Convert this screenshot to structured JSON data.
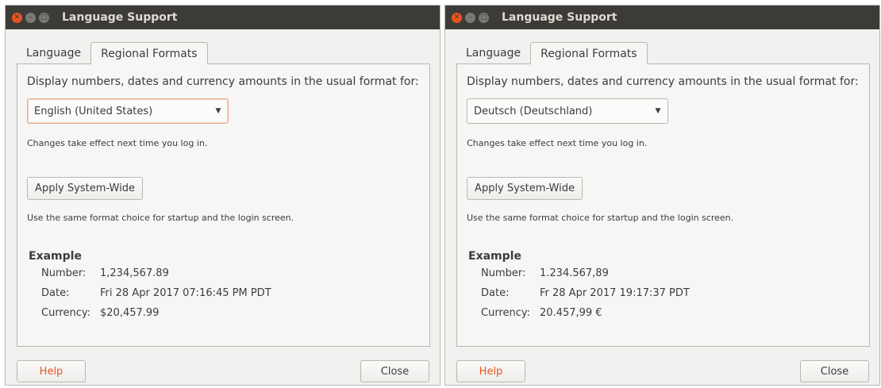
{
  "windows": [
    {
      "title": "Language Support",
      "tabs": [
        "Language",
        "Regional Formats"
      ],
      "active_tab": "Regional Formats",
      "heading": "Display numbers, dates and currency amounts in the usual format for:",
      "format_select": {
        "value": "English (United States)"
      },
      "changes_note": "Changes take effect next time you log in.",
      "apply_button": "Apply System-Wide",
      "apply_note": "Use the same format choice for startup and the login screen.",
      "example": {
        "title": "Example",
        "number_label": "Number:",
        "number_value": "1,234,567.89",
        "date_label": "Date:",
        "date_value": "Fri 28 Apr 2017 07:16:45 PM PDT",
        "currency_label": "Currency:",
        "currency_value": "$20,457.99"
      },
      "help_button": "Help",
      "close_button": "Close"
    },
    {
      "title": "Language Support",
      "tabs": [
        "Language",
        "Regional Formats"
      ],
      "active_tab": "Regional Formats",
      "heading": "Display numbers, dates and currency amounts in the usual format for:",
      "format_select": {
        "value": "Deutsch (Deutschland)"
      },
      "changes_note": "Changes take effect next time you log in.",
      "apply_button": "Apply System-Wide",
      "apply_note": "Use the same format choice for startup and the login screen.",
      "example": {
        "title": "Example",
        "number_label": "Number:",
        "number_value": "1.234.567,89",
        "date_label": "Date:",
        "date_value": "Fr 28 Apr 2017 19:17:37 PDT",
        "currency_label": "Currency:",
        "currency_value": "20.457,99 €"
      },
      "help_button": "Help",
      "close_button": "Close"
    }
  ],
  "colors": {
    "titlebar": "#3c3b37",
    "close_button": "#e95420",
    "help_text": "#e95420",
    "window_bg": "#f2f1f0"
  },
  "icons": {
    "window_close": "close-icon",
    "window_minimize": "minimize-icon",
    "window_maximize": "maximize-icon",
    "dropdown": "chevron-down-icon"
  }
}
